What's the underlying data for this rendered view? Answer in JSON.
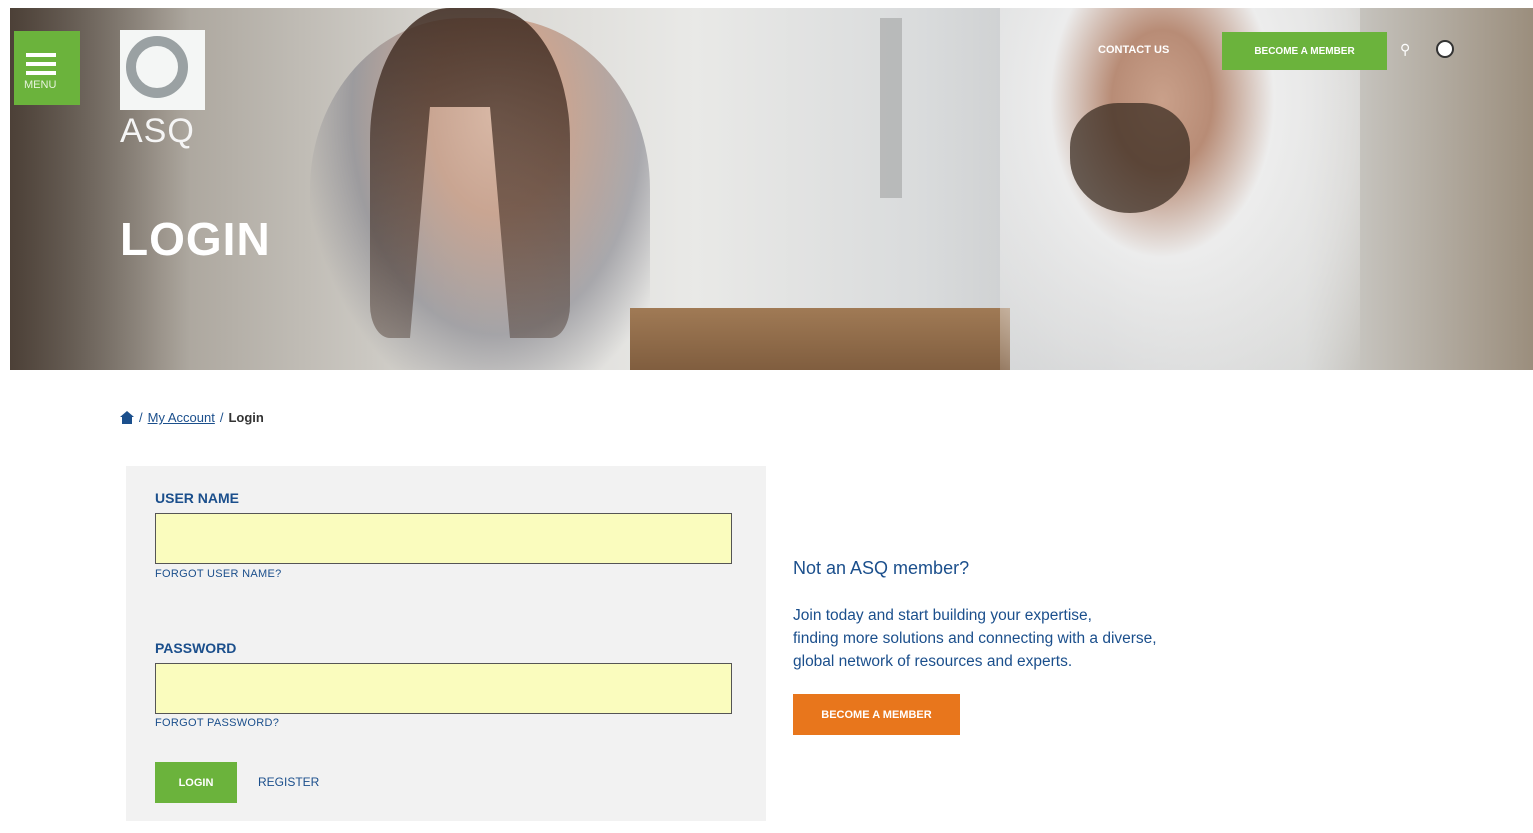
{
  "header": {
    "menu_label": "MENU",
    "logo_text": "ASQ",
    "title": "LOGIN",
    "contact_label": "CONTACT US",
    "become_member_label": "BECOME A MEMBER",
    "icons": [
      "menu-icon",
      "search-icon",
      "globe-icon"
    ]
  },
  "breadcrumb": {
    "my_account": "My Account",
    "separator": "/",
    "current": "Login"
  },
  "login_form": {
    "username_label": "USER NAME",
    "username_value": "",
    "forgot_username": "FORGOT USER NAME?",
    "password_label": "PASSWORD",
    "password_value": "",
    "forgot_password": "FORGOT PASSWORD?",
    "login_button": "LOGIN",
    "register_link": "REGISTER"
  },
  "promo": {
    "title": "Not an ASQ member?",
    "lines": [
      "Join today and start building your expertise,",
      "finding more solutions and connecting with a diverse,",
      "global network of resources and experts."
    ],
    "button": "BECOME A MEMBER"
  },
  "colors": {
    "brand_green": "#6bb33c",
    "brand_orange": "#e8761c",
    "text_blue": "#1b4f8c",
    "field_yellow": "#fafcbe"
  }
}
